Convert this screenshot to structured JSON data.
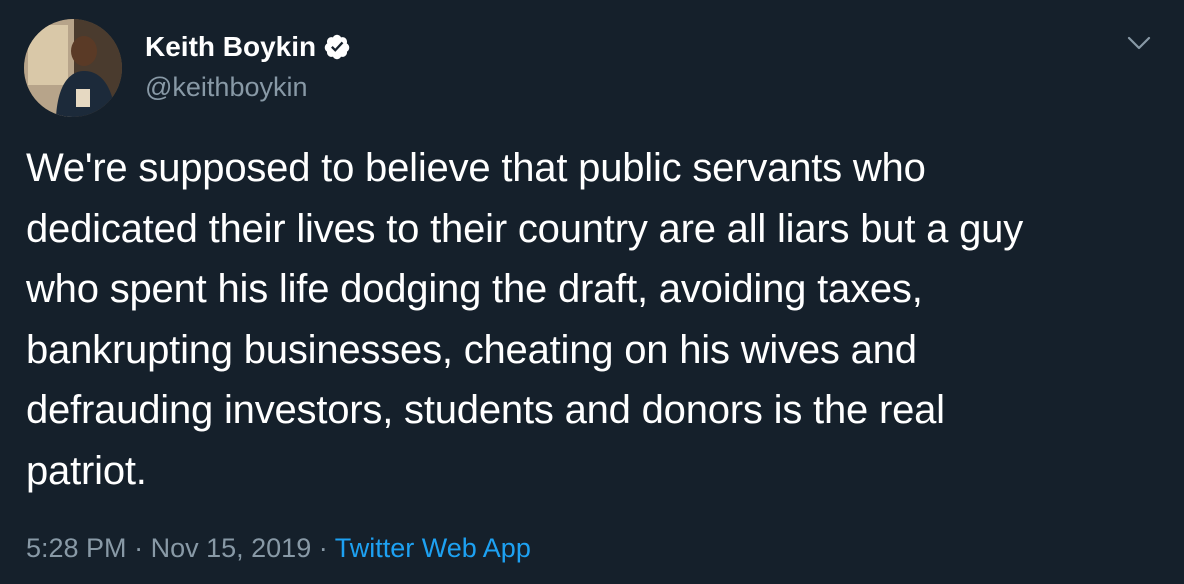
{
  "author": {
    "display_name": "Keith Boykin",
    "handle": "@keithboykin",
    "verified": true
  },
  "tweet": {
    "text": "We're supposed to believe that public servants who\ndedicated their lives to their country are all liars but a guy\nwho spent his life dodging the draft, avoiding taxes,\nbankrupting businesses, cheating on his wives and\ndefrauding investors, students and donors is the real\npatriot.",
    "time": "5:28 PM",
    "separator": "·",
    "date": "Nov 15, 2019",
    "source": "Twitter Web App"
  },
  "icons": {
    "verified": "verified-badge-icon",
    "menu": "chevron-down-icon"
  },
  "colors": {
    "background": "#15202b",
    "primary_text": "#ffffff",
    "secondary_text": "#8899a6",
    "link": "#1da1f2"
  }
}
